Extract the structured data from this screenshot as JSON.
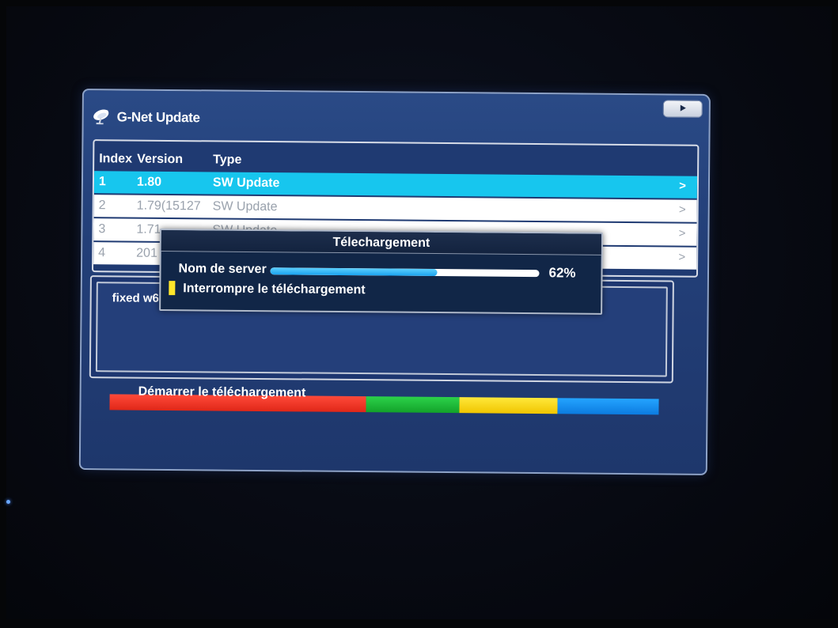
{
  "window": {
    "title": "G-Net Update"
  },
  "list": {
    "headers": {
      "index": "Index",
      "version": "Version",
      "type": "Type"
    },
    "rows": [
      {
        "index": "1",
        "version": "1.80",
        "type": "SW Update",
        "chevron": ">"
      },
      {
        "index": "2",
        "version": "1.79(15127",
        "type": "SW Update",
        "chevron": ">"
      },
      {
        "index": "3",
        "version": "1.71",
        "type": "SW Update",
        "chevron": ">"
      },
      {
        "index": "4",
        "version": "201",
        "type": "",
        "chevron": ">"
      }
    ]
  },
  "description": {
    "text": "fixed w6"
  },
  "color_keys": {
    "red_label": "Démarrer le téléchargement",
    "colors": {
      "red": "#e02718",
      "green": "#13a22a",
      "yellow": "#f0c500",
      "blue": "#0c7be0"
    }
  },
  "dialog": {
    "title": "Télechargement",
    "server_label": "Nom de server",
    "progress_percent_label": "62%",
    "progress_value": 0.62,
    "interrupt_label": "Interrompre le téléchargement"
  },
  "icons": {
    "title_icon": "satellite-dish-icon",
    "play_icon": "play-icon",
    "chevron_icon": "chevron-right-icon"
  },
  "theme": {
    "panel": "#233f78",
    "highlight": "#17c6ee",
    "dialog": "#112647"
  }
}
